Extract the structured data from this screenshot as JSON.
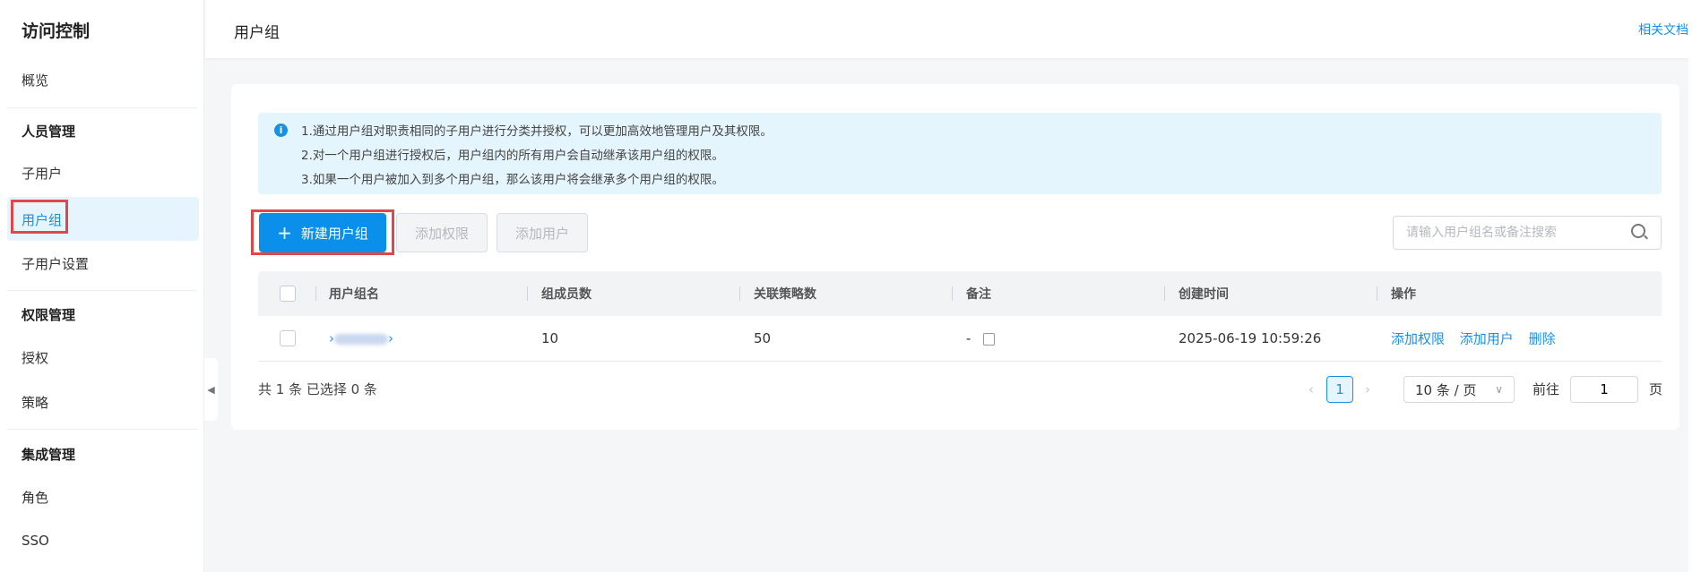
{
  "sidebar": {
    "title": "访问控制",
    "overview": "概览",
    "groups": [
      {
        "label": "人员管理",
        "items": [
          "子用户",
          "用户组",
          "子用户设置"
        ]
      },
      {
        "label": "权限管理",
        "items": [
          "授权",
          "策略"
        ]
      },
      {
        "label": "集成管理",
        "items": [
          "角色",
          "SSO"
        ]
      }
    ]
  },
  "header": {
    "title": "用户组",
    "doc_link": "相关文档"
  },
  "info": {
    "lines": [
      "1.通过用户组对职责相同的子用户进行分类并授权，可以更加高效地管理用户及其权限。",
      "2.对一个用户组进行授权后，用户组内的所有用户会自动继承该用户组的权限。",
      "3.如果一个用户被加入到多个用户组，那么该用户将会继承多个用户组的权限。"
    ]
  },
  "toolbar": {
    "new_group": "新建用户组",
    "add_permission": "添加权限",
    "add_user": "添加用户",
    "search_placeholder": "请输入用户组名或备注搜索"
  },
  "table": {
    "columns": [
      "用户组名",
      "组成员数",
      "关联策略数",
      "备注",
      "创建时间",
      "操作"
    ],
    "rows": [
      {
        "name": "",
        "members": "10",
        "policies": "50",
        "remark": "-",
        "created": "2025-06-19 10:59:26",
        "actions": [
          "添加权限",
          "添加用户",
          "删除"
        ]
      }
    ]
  },
  "footer": {
    "summary": "共 1 条 已选择 0 条",
    "current_page": "1",
    "page_size": "10 条 / 页",
    "goto_label": "前往",
    "goto_value": "1",
    "page_suffix": "页"
  },
  "colors": {
    "primary": "#0a8fea",
    "link": "#1890e6",
    "highlight": "#e0474a"
  }
}
